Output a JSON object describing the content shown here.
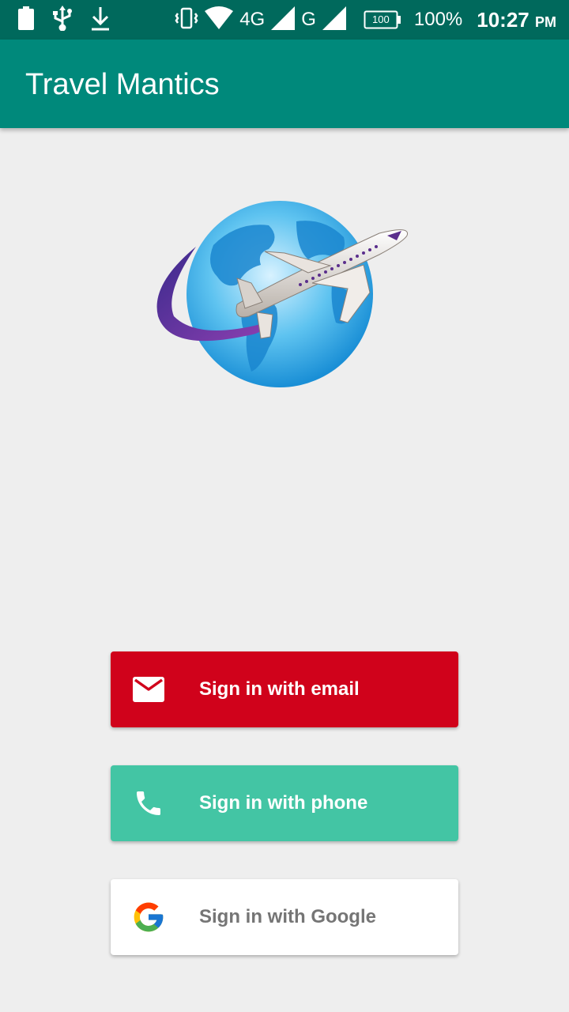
{
  "status_bar": {
    "network_4g": "4G",
    "network_g": "G",
    "battery_level": "100",
    "battery_percent": "100%",
    "time": "10:27",
    "time_suffix": "PM",
    "icons": [
      "battery-icon",
      "usb-icon",
      "download-icon",
      "vibrate-icon",
      "wifi-icon",
      "signal-icon",
      "signal-icon"
    ]
  },
  "app_bar": {
    "title": "Travel Mantics",
    "color": "#00897b"
  },
  "logo": {
    "icon": "globe-airplane-logo"
  },
  "sign_in": {
    "email": {
      "label": "Sign in with email",
      "icon": "mail-icon",
      "color": "#d0021b"
    },
    "phone": {
      "label": "Sign in with phone",
      "icon": "phone-icon",
      "color": "#43c5a4"
    },
    "google": {
      "label": "Sign in with Google",
      "icon": "google-icon",
      "color": "#ffffff"
    }
  }
}
